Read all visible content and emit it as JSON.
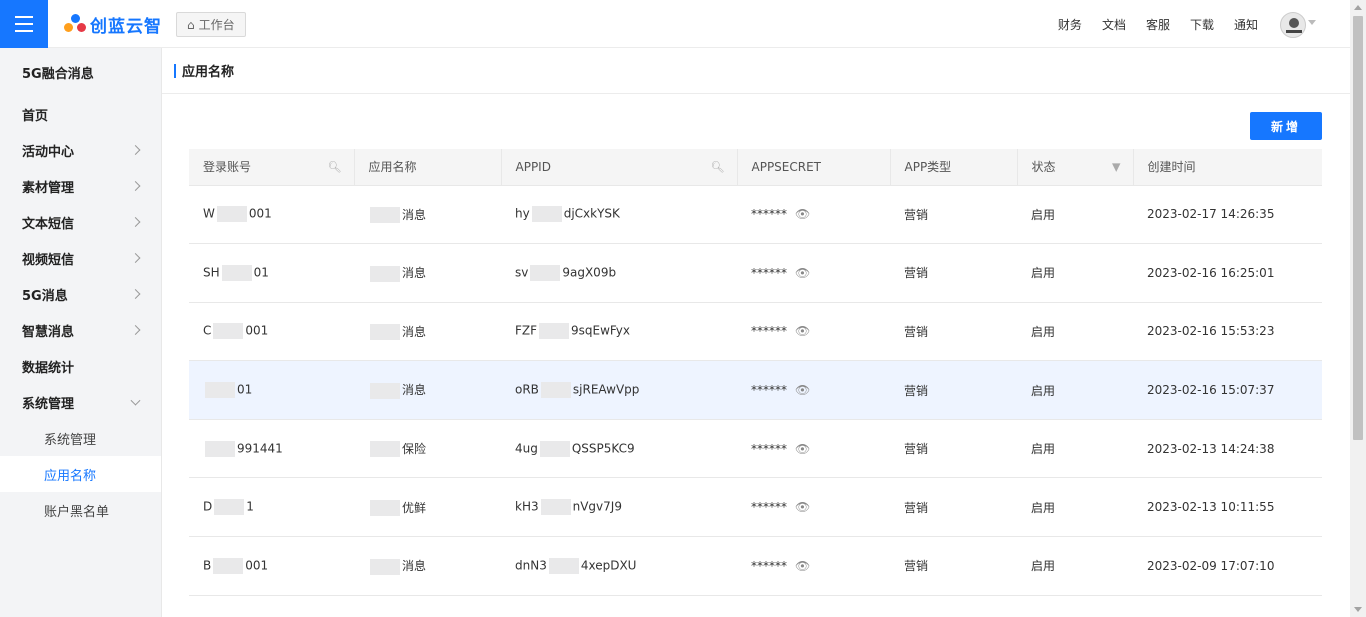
{
  "header": {
    "logo_text": "创蓝云智",
    "workbench_label": "工作台",
    "links": [
      "财务",
      "文档",
      "客服",
      "下载",
      "通知"
    ]
  },
  "sidebar": {
    "title": "5G融合消息",
    "items": [
      {
        "label": "首页",
        "arrow": "none"
      },
      {
        "label": "活动中心",
        "arrow": "right"
      },
      {
        "label": "素材管理",
        "arrow": "right"
      },
      {
        "label": "文本短信",
        "arrow": "right"
      },
      {
        "label": "视频短信",
        "arrow": "right"
      },
      {
        "label": "5G消息",
        "arrow": "right"
      },
      {
        "label": "智慧消息",
        "arrow": "right"
      },
      {
        "label": "数据统计",
        "arrow": "none"
      },
      {
        "label": "系统管理",
        "arrow": "down"
      }
    ],
    "subitems": [
      {
        "label": "系统管理",
        "active": false
      },
      {
        "label": "应用名称",
        "active": true
      },
      {
        "label": "账户黑名单",
        "active": false
      }
    ]
  },
  "main": {
    "title": "应用名称",
    "add_button": "新增"
  },
  "table": {
    "columns": [
      "登录账号",
      "应用名称",
      "APPID",
      "APPSECRET",
      "APP类型",
      "状态",
      "创建时间"
    ],
    "rows": [
      {
        "account": [
          "W",
          "001"
        ],
        "app_name": [
          "",
          "消息"
        ],
        "appid": [
          "hy",
          "djCxkYSK"
        ],
        "secret": "******",
        "type": "营销",
        "status": "启用",
        "created": "2023-02-17 14:26:35"
      },
      {
        "account": [
          "SH",
          "01"
        ],
        "app_name": [
          "",
          "消息"
        ],
        "appid": [
          "sv",
          "9agX09b"
        ],
        "secret": "******",
        "type": "营销",
        "status": "启用",
        "created": "2023-02-16 16:25:01"
      },
      {
        "account": [
          "C",
          "001"
        ],
        "app_name": [
          "",
          "消息"
        ],
        "appid": [
          "FZF",
          "9sqEwFyx"
        ],
        "secret": "******",
        "type": "营销",
        "status": "启用",
        "created": "2023-02-16 15:53:23"
      },
      {
        "account": [
          "",
          "01"
        ],
        "app_name": [
          "",
          "消息"
        ],
        "appid": [
          "oRB",
          "sjREAwVpp"
        ],
        "secret": "******",
        "type": "营销",
        "status": "启用",
        "created": "2023-02-16 15:07:37"
      },
      {
        "account": [
          "",
          "991441"
        ],
        "app_name": [
          "",
          "保险"
        ],
        "appid": [
          "4ug",
          "QSSP5KC9"
        ],
        "secret": "******",
        "type": "营销",
        "status": "启用",
        "created": "2023-02-13 14:24:38"
      },
      {
        "account": [
          "D",
          "1"
        ],
        "app_name": [
          "",
          "优鲜"
        ],
        "appid": [
          "kH3",
          "nVgv7J9"
        ],
        "secret": "******",
        "type": "营销",
        "status": "启用",
        "created": "2023-02-13 10:11:55"
      },
      {
        "account": [
          "B",
          "001"
        ],
        "app_name": [
          "",
          "消息"
        ],
        "appid": [
          "dnN3",
          "4xepDXU"
        ],
        "secret": "******",
        "type": "营销",
        "status": "启用",
        "created": "2023-02-09 17:07:10"
      }
    ]
  },
  "colors": {
    "primary": "#1677ff",
    "sidebar_bg": "#f3f4f6",
    "table_header_bg": "#f5f5f5",
    "row_hover_bg": "#eef4ff"
  }
}
